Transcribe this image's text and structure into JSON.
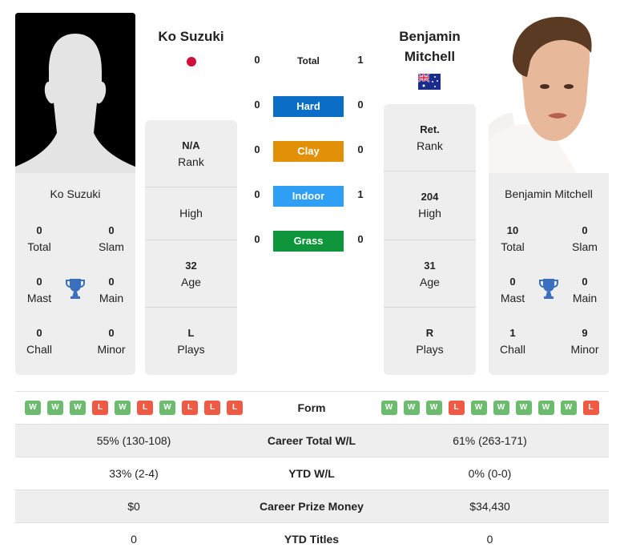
{
  "colors": {
    "hard": "#0a6ec6",
    "clay": "#e39009",
    "indoor": "#2f9ef5",
    "grass": "#0f963c",
    "win": "#6cbb6f",
    "loss": "#ee5a44",
    "trophy": "#3a6fbd"
  },
  "player1": {
    "name": "Ko Suzuki",
    "flag": "japan-flag",
    "photo": "silhouette-placeholder",
    "titles": {
      "total": {
        "value": "0",
        "label": "Total"
      },
      "slam": {
        "value": "0",
        "label": "Slam"
      },
      "mast": {
        "value": "0",
        "label": "Mast"
      },
      "main": {
        "value": "0",
        "label": "Main"
      },
      "chall": {
        "value": "0",
        "label": "Chall"
      },
      "minor": {
        "value": "0",
        "label": "Minor"
      }
    },
    "info": {
      "rank": {
        "value": "N/A",
        "label": "Rank"
      },
      "high": {
        "value": "",
        "label": "High"
      },
      "age": {
        "value": "32",
        "label": "Age"
      },
      "plays": {
        "value": "L",
        "label": "Plays"
      }
    },
    "form": [
      "W",
      "W",
      "W",
      "L",
      "W",
      "L",
      "W",
      "L",
      "L",
      "L"
    ]
  },
  "player2": {
    "name": "Benjamin Mitchell",
    "name_line1": "Benjamin",
    "name_line2": "Mitchell",
    "flag": "australia-flag",
    "photo": "player-headshot",
    "titles": {
      "total": {
        "value": "10",
        "label": "Total"
      },
      "slam": {
        "value": "0",
        "label": "Slam"
      },
      "mast": {
        "value": "0",
        "label": "Mast"
      },
      "main": {
        "value": "0",
        "label": "Main"
      },
      "chall": {
        "value": "1",
        "label": "Chall"
      },
      "minor": {
        "value": "9",
        "label": "Minor"
      }
    },
    "info": {
      "rank": {
        "value": "Ret.",
        "label": "Rank"
      },
      "high": {
        "value": "204",
        "label": "High"
      },
      "age": {
        "value": "31",
        "label": "Age"
      },
      "plays": {
        "value": "R",
        "label": "Plays"
      }
    },
    "form": [
      "W",
      "W",
      "W",
      "L",
      "W",
      "W",
      "W",
      "W",
      "W",
      "L"
    ]
  },
  "h2h": [
    {
      "label": "Total",
      "p1": "0",
      "p2": "1",
      "surface": null
    },
    {
      "label": "Hard",
      "p1": "0",
      "p2": "0",
      "surface": "hard"
    },
    {
      "label": "Clay",
      "p1": "0",
      "p2": "0",
      "surface": "clay"
    },
    {
      "label": "Indoor",
      "p1": "0",
      "p2": "1",
      "surface": "indoor"
    },
    {
      "label": "Grass",
      "p1": "0",
      "p2": "0",
      "surface": "grass"
    }
  ],
  "table": {
    "form_label": "Form",
    "rows": [
      {
        "label": "Career Total W/L",
        "p1": "55% (130-108)",
        "p2": "61% (263-171)"
      },
      {
        "label": "YTD W/L",
        "p1": "33% (2-4)",
        "p2": "0% (0-0)"
      },
      {
        "label": "Career Prize Money",
        "p1": "$0",
        "p2": "$34,430"
      },
      {
        "label": "YTD Titles",
        "p1": "0",
        "p2": "0"
      }
    ]
  }
}
